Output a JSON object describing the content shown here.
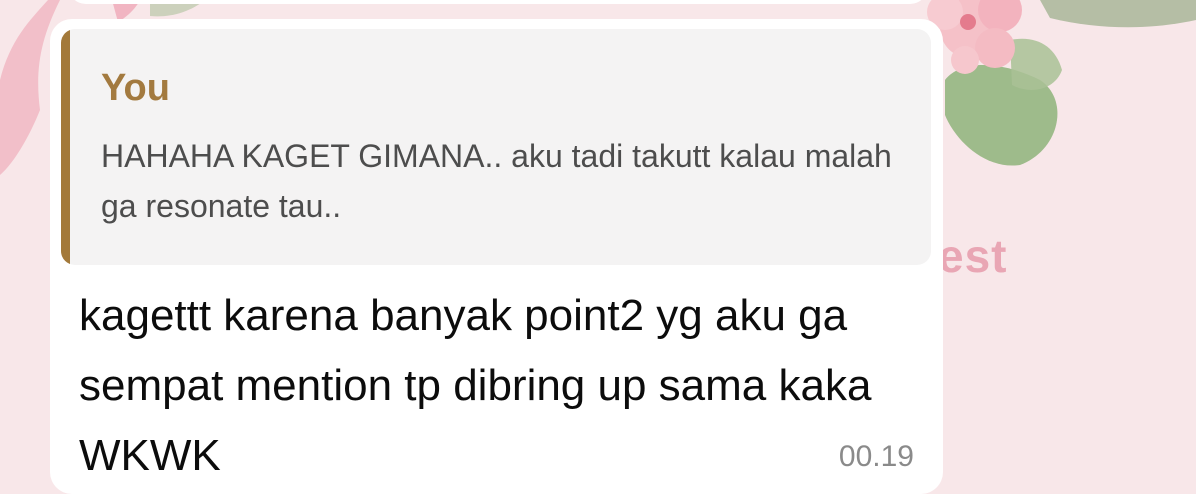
{
  "chat": {
    "wallpaper_text": "est",
    "message": {
      "quote": {
        "author": "You",
        "text": "HAHAHA KAGET GIMANA.. aku tadi takutt kalau malah ga resonate tau.."
      },
      "text": "kagettt karena banyak point2 yg aku ga sempat mention tp dibring up sama kaka WKWK",
      "time": "00.19"
    }
  },
  "colors": {
    "background": "#f8e7e9",
    "bubble": "#ffffff",
    "quote_background": "#f4f3f3",
    "quote_accent": "#a3793a",
    "quote_author": "#a37a3f",
    "quote_text": "#4d4d4d",
    "message_text": "#0c0c0c",
    "timestamp": "#8a8a8a"
  },
  "icons": [
    "flower-decoration-icon",
    "leaf-decoration-icon",
    "ribbon-decoration-icon"
  ]
}
